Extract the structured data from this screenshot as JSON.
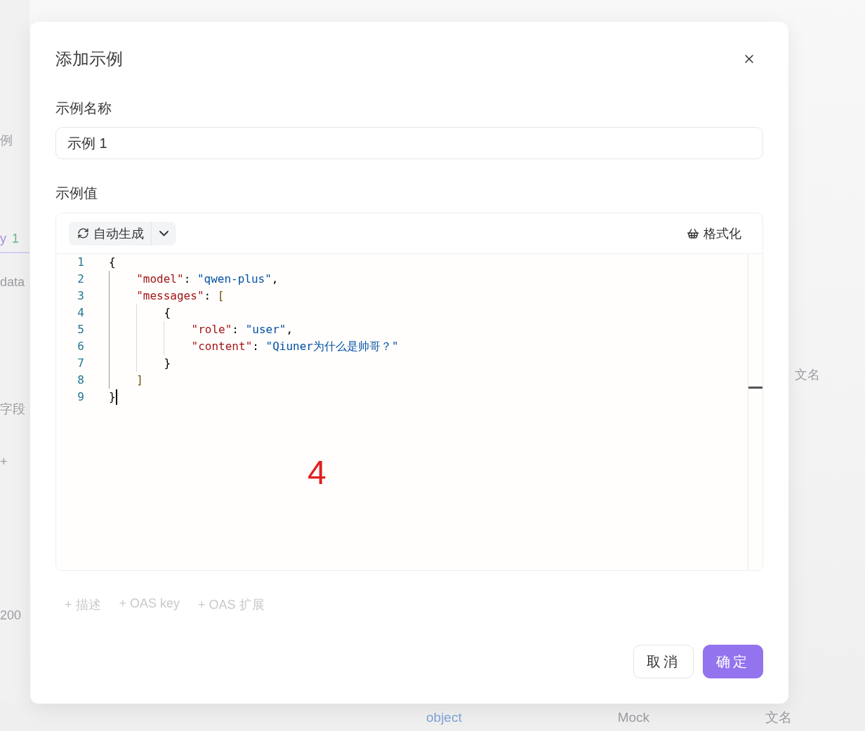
{
  "background": {
    "left": [
      {
        "kind": "text",
        "label": "例"
      },
      {
        "kind": "tab",
        "label": "y",
        "count": "1",
        "selected": true
      },
      {
        "kind": "text",
        "label": "data"
      },
      {
        "kind": "text",
        "label": "字段"
      },
      {
        "kind": "text",
        "label": "+"
      },
      {
        "kind": "text",
        "label": "200"
      }
    ],
    "right": [
      "文名"
    ],
    "bottom": [
      {
        "kind": "type",
        "label": "object"
      },
      {
        "kind": "text",
        "label": "Mock"
      },
      {
        "kind": "text",
        "label": "文名"
      }
    ]
  },
  "dialog": {
    "title": "添加示例",
    "name_field": {
      "label": "示例名称",
      "value": "示例 1"
    },
    "value_field": {
      "label": "示例值",
      "generate": "自动生成",
      "format": "格式化",
      "lines": [
        {
          "number": "1",
          "cursor": false,
          "tokens": [
            {
              "kind": "bracket",
              "text": "{"
            }
          ]
        },
        {
          "number": "2",
          "cursor": false,
          "tokens": [
            {
              "kind": "key",
              "text": "    \"model\""
            },
            {
              "kind": "punct",
              "text": ": "
            },
            {
              "kind": "string",
              "text": "\"qwen-plus\""
            },
            {
              "kind": "punct",
              "text": ","
            }
          ]
        },
        {
          "number": "3",
          "cursor": false,
          "tokens": [
            {
              "kind": "key",
              "text": "    \"messages\""
            },
            {
              "kind": "punct",
              "text": ": "
            },
            {
              "kind": "bracket2",
              "text": "["
            }
          ]
        },
        {
          "number": "4",
          "cursor": false,
          "tokens": [
            {
              "kind": "bracket",
              "text": "        {"
            }
          ]
        },
        {
          "number": "5",
          "cursor": false,
          "tokens": [
            {
              "kind": "key",
              "text": "            \"role\""
            },
            {
              "kind": "punct",
              "text": ": "
            },
            {
              "kind": "string",
              "text": "\"user\""
            },
            {
              "kind": "punct",
              "text": ","
            }
          ]
        },
        {
          "number": "6",
          "cursor": false,
          "tokens": [
            {
              "kind": "key",
              "text": "            \"content\""
            },
            {
              "kind": "punct",
              "text": ": "
            },
            {
              "kind": "string",
              "text": "\"Qiuner为什么是帅哥？\""
            }
          ]
        },
        {
          "number": "7",
          "cursor": false,
          "tokens": [
            {
              "kind": "bracket",
              "text": "        }"
            }
          ]
        },
        {
          "number": "8",
          "cursor": false,
          "tokens": [
            {
              "kind": "bracket2",
              "text": "    ]"
            }
          ]
        },
        {
          "number": "9",
          "cursor": true,
          "tokens": [
            {
              "kind": "bracket",
              "text": "}"
            }
          ]
        }
      ]
    },
    "annotation": "4",
    "links": [
      "+ 描述",
      "+ OAS key",
      "+ OAS 扩展"
    ],
    "buttons": [
      {
        "kind": "secondary",
        "label": "取消"
      },
      {
        "kind": "primary",
        "label": "确定"
      }
    ]
  }
}
